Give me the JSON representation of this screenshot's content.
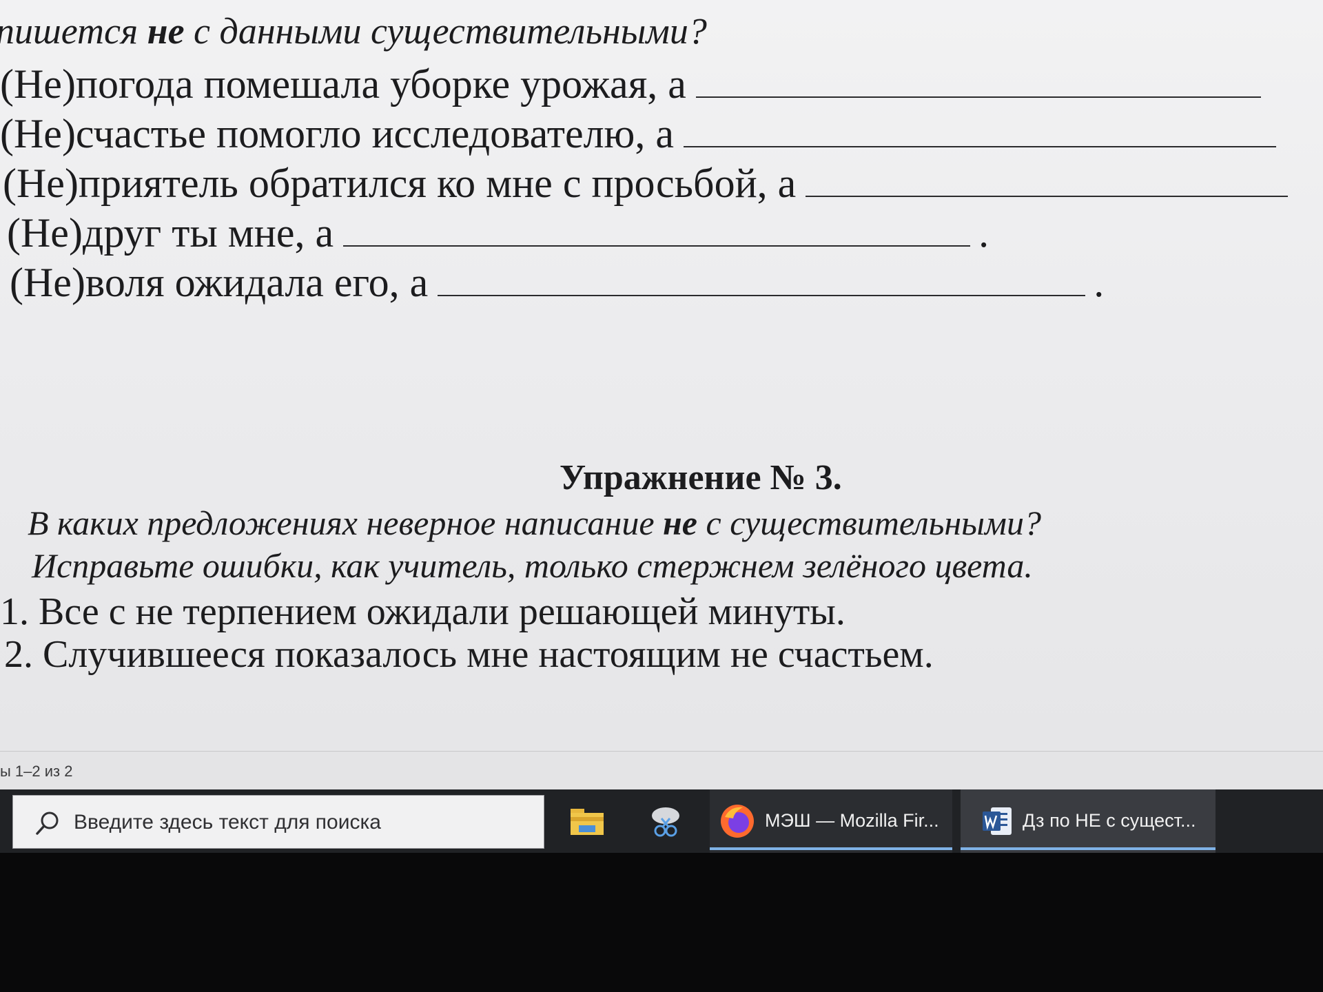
{
  "document": {
    "question_prefix": "пишется ",
    "question_bold": "не",
    "question_suffix": " с данными существительными?",
    "sentences": [
      {
        "text": "(Не)погода помешала уборке урожая, а",
        "end": ""
      },
      {
        "text": "(Не)счастье помогло исследователю, а",
        "end": ""
      },
      {
        "text": "(Не)приятель обратился ко мне с просьбой, а",
        "end": ""
      },
      {
        "text": "(Не)друг ты мне, а",
        "end": "."
      },
      {
        "text": "(Не)воля ожидала его, а",
        "end": "."
      }
    ],
    "exercise": {
      "title": "Упражнение № 3.",
      "question1_prefix": "В каких предложениях неверное написание ",
      "question1_bold": "не",
      "question1_suffix": " с существительными?",
      "question2": "Исправьте ошибки, как учитель, только стержнем зелёного цвета.",
      "items": [
        "1. Все с не терпением ожидали решающей минуты.",
        "2. Случившееся показалось мне настоящим не счастьем."
      ]
    }
  },
  "status_bar": {
    "pages": "ы 1–2 из 2"
  },
  "taskbar": {
    "search_placeholder": "Введите здесь текст для поиска",
    "apps": [
      {
        "icon": "file-explorer-icon"
      },
      {
        "icon": "snipping-tool-icon"
      },
      {
        "icon": "firefox-icon",
        "label": "МЭШ — Mozilla Fir..."
      },
      {
        "icon": "word-icon",
        "label": "Дз по НЕ с сущест..."
      }
    ]
  },
  "colors": {
    "page": "#ececee",
    "text": "#1c1c1e",
    "taskbar": "#202225",
    "active_underline": "#7fb2e6"
  }
}
